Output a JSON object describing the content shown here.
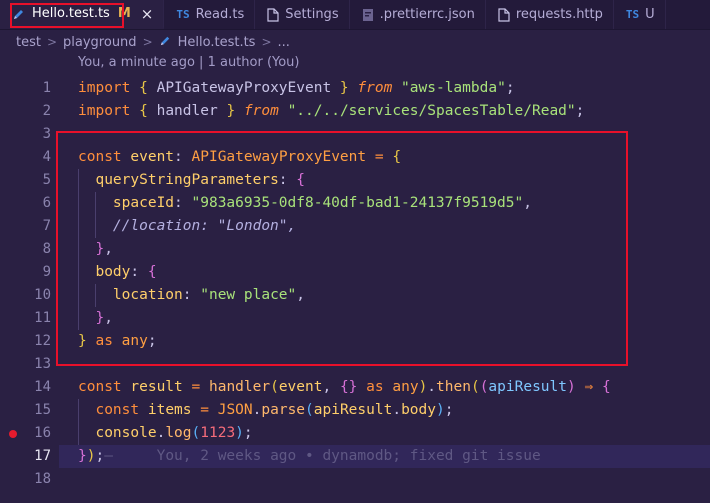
{
  "tabs": [
    {
      "label": "Hello.test.ts",
      "modified": "M",
      "close": "×",
      "icon": "ts-pen-icon",
      "active": true
    },
    {
      "label": "Read.ts",
      "icon_text": "TS",
      "active": false
    },
    {
      "label": "Settings",
      "icon": "document-icon",
      "active": false
    },
    {
      "label": ".prettierrc.json",
      "icon": "prettier-icon",
      "active": false
    },
    {
      "label": "requests.http",
      "icon": "document-icon",
      "active": false
    },
    {
      "label": "U",
      "icon_text": "TS",
      "active": false
    }
  ],
  "breadcrumb": {
    "items": [
      "test",
      "playground",
      "Hello.test.ts",
      "..."
    ],
    "sep": ">"
  },
  "blame": "You, a minute ago | 1 author (You)",
  "editor": {
    "line_numbers": [
      "1",
      "2",
      "3",
      "4",
      "5",
      "6",
      "7",
      "8",
      "9",
      "10",
      "11",
      "12",
      "13",
      "14",
      "15",
      "16",
      "17",
      "18"
    ],
    "current_line": 17,
    "breakpoint_line": 16,
    "inline_blame": "You, 2 weeks ago • dynamodb; fixed git issue",
    "lines": [
      [
        [
          "kw",
          "import"
        ],
        [
          "punc",
          " "
        ],
        [
          "brace",
          "{"
        ],
        [
          "punc",
          " APIGatewayProxyEvent "
        ],
        [
          "brace",
          "}"
        ],
        [
          "punc",
          " "
        ],
        [
          "kwi",
          "from"
        ],
        [
          "punc",
          " "
        ],
        [
          "str",
          "\"aws-lambda\""
        ],
        [
          "punc",
          ";"
        ]
      ],
      [
        [
          "kw",
          "import"
        ],
        [
          "punc",
          " "
        ],
        [
          "brace",
          "{"
        ],
        [
          "punc",
          " handler "
        ],
        [
          "brace",
          "}"
        ],
        [
          "punc",
          " "
        ],
        [
          "kwi",
          "from"
        ],
        [
          "punc",
          " "
        ],
        [
          "str",
          "\"../../services/SpacesTable/Read\""
        ],
        [
          "punc",
          ";"
        ]
      ],
      [],
      [
        [
          "kw",
          "const"
        ],
        [
          "punc",
          " "
        ],
        [
          "var",
          "event"
        ],
        [
          "punc",
          ": "
        ],
        [
          "type",
          "APIGatewayProxyEvent"
        ],
        [
          "punc",
          " "
        ],
        [
          "op",
          "="
        ],
        [
          "punc",
          " "
        ],
        [
          "brace",
          "{"
        ]
      ],
      [
        [
          "punc",
          "  "
        ],
        [
          "prop",
          "queryStringParameters"
        ],
        [
          "punc",
          ": "
        ],
        [
          "brace2",
          "{"
        ]
      ],
      [
        [
          "punc",
          "    "
        ],
        [
          "prop",
          "spaceId"
        ],
        [
          "punc",
          ": "
        ],
        [
          "str",
          "\"983a6935-0df8-40df-bad1-24137f9519d5\""
        ],
        [
          "punc",
          ","
        ]
      ],
      [
        [
          "punc",
          "    "
        ],
        [
          "cmt",
          "//location: \"London\","
        ]
      ],
      [
        [
          "punc",
          "  "
        ],
        [
          "brace2",
          "}"
        ],
        [
          "punc",
          ","
        ]
      ],
      [
        [
          "punc",
          "  "
        ],
        [
          "prop",
          "body"
        ],
        [
          "punc",
          ": "
        ],
        [
          "brace2",
          "{"
        ]
      ],
      [
        [
          "punc",
          "    "
        ],
        [
          "prop",
          "location"
        ],
        [
          "punc",
          ": "
        ],
        [
          "str",
          "\"new place\""
        ],
        [
          "punc",
          ","
        ]
      ],
      [
        [
          "punc",
          "  "
        ],
        [
          "brace2",
          "}"
        ],
        [
          "punc",
          ","
        ]
      ],
      [
        [
          "brace",
          "}"
        ],
        [
          "punc",
          " "
        ],
        [
          "kw",
          "as"
        ],
        [
          "punc",
          " "
        ],
        [
          "type",
          "any"
        ],
        [
          "punc",
          ";"
        ]
      ],
      [],
      [
        [
          "kw",
          "const"
        ],
        [
          "punc",
          " "
        ],
        [
          "var",
          "result"
        ],
        [
          "punc",
          " "
        ],
        [
          "op",
          "="
        ],
        [
          "punc",
          " "
        ],
        [
          "fn",
          "handler"
        ],
        [
          "brace",
          "("
        ],
        [
          "var",
          "event"
        ],
        [
          "punc",
          ", "
        ],
        [
          "brace2",
          "{}"
        ],
        [
          "punc",
          " "
        ],
        [
          "kw",
          "as"
        ],
        [
          "punc",
          " "
        ],
        [
          "type",
          "any"
        ],
        [
          "brace",
          ")"
        ],
        [
          "punc",
          "."
        ],
        [
          "fn",
          "then"
        ],
        [
          "brace",
          "("
        ],
        [
          "brace2",
          "("
        ],
        [
          "param",
          "apiResult"
        ],
        [
          "brace2",
          ")"
        ],
        [
          "punc",
          " "
        ],
        [
          "op",
          "⇒"
        ],
        [
          "punc",
          " "
        ],
        [
          "brace2",
          "{"
        ]
      ],
      [
        [
          "punc",
          "  "
        ],
        [
          "kw",
          "const"
        ],
        [
          "punc",
          " "
        ],
        [
          "var",
          "items"
        ],
        [
          "punc",
          " "
        ],
        [
          "op",
          "="
        ],
        [
          "punc",
          " "
        ],
        [
          "type",
          "JSON"
        ],
        [
          "punc",
          "."
        ],
        [
          "fn",
          "parse"
        ],
        [
          "brace3",
          "("
        ],
        [
          "var",
          "apiResult"
        ],
        [
          "punc",
          "."
        ],
        [
          "prop",
          "body"
        ],
        [
          "brace3",
          ")"
        ],
        [
          "punc",
          ";"
        ]
      ],
      [
        [
          "punc",
          "  "
        ],
        [
          "var",
          "console"
        ],
        [
          "punc",
          "."
        ],
        [
          "fn",
          "log"
        ],
        [
          "brace3",
          "("
        ],
        [
          "num",
          "1123"
        ],
        [
          "brace3",
          ")"
        ],
        [
          "punc",
          ";"
        ]
      ],
      [
        [
          "brace2",
          "}"
        ],
        [
          "brace",
          ")"
        ],
        [
          "punc",
          ";"
        ],
        [
          "ghost",
          "—"
        ]
      ],
      []
    ]
  },
  "colors": {
    "background": "#2a2043",
    "tabbar": "#231a3a",
    "highlight_box": "#e8102a",
    "breakpoint": "#e51b2e"
  }
}
